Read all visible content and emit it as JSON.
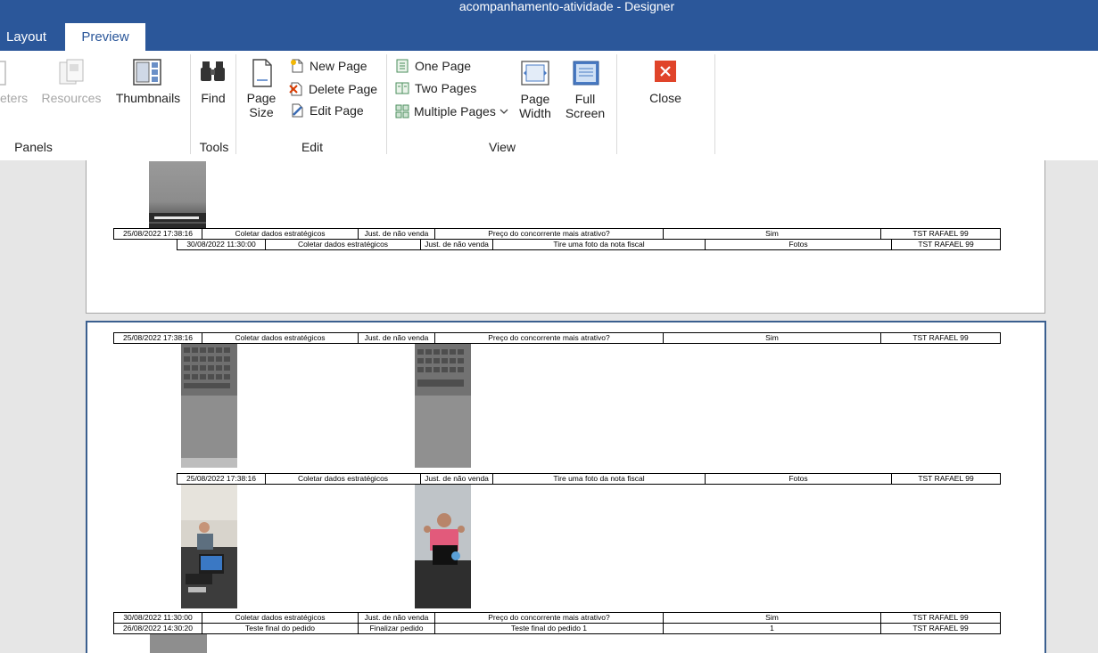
{
  "window": {
    "title": "acompanhamento-atividade - Designer"
  },
  "tabs": {
    "layout": "Layout",
    "preview": "Preview"
  },
  "ribbon": {
    "panels": {
      "parameters": "eters",
      "resources": "Resources",
      "thumbnails": "Thumbnails",
      "group": "Panels"
    },
    "tools": {
      "find": "Find",
      "group": "Tools"
    },
    "edit": {
      "page_size_1": "Page",
      "page_size_2": "Size",
      "new_page": "New Page",
      "delete_page": "Delete Page",
      "edit_page": "Edit Page",
      "group": "Edit"
    },
    "view": {
      "one_page": "One Page",
      "two_pages": "Two Pages",
      "multiple_pages": "Multiple Pages",
      "page_width_1": "Page",
      "page_width_2": "Width",
      "full_screen_1": "Full",
      "full_screen_2": "Screen",
      "group": "View"
    },
    "close": {
      "label": "Close"
    }
  },
  "rows": {
    "p1a": [
      "25/08/2022 17:38:16",
      "Coletar dados estratégicos",
      "Just. de não venda",
      "Preço do concorrente mais atrativo?",
      "Sim",
      "TST RAFAEL 99"
    ],
    "p1b": [
      "30/08/2022 11:30:00",
      "Coletar dados estratégicos",
      "Just. de não venda",
      "Tire uma foto da nota fiscal",
      "Fotos",
      "TST RAFAEL 99"
    ],
    "p2a": [
      "25/08/2022 17:38:16",
      "Coletar dados estratégicos",
      "Just. de não venda",
      "Preço do concorrente mais atrativo?",
      "Sim",
      "TST RAFAEL 99"
    ],
    "p2b": [
      "25/08/2022 17:38:16",
      "Coletar dados estratégicos",
      "Just. de não venda",
      "Tire uma foto da nota fiscal",
      "Fotos",
      "TST RAFAEL 99"
    ],
    "p2c": [
      "30/08/2022 11:30:00",
      "Coletar dados estratégicos",
      "Just. de não venda",
      "Preço do concorrente mais atrativo?",
      "Sim",
      "TST RAFAEL 99"
    ],
    "p2d": [
      "26/08/2022 14:30:20",
      "Teste final do pedido",
      "Finalizar pedido",
      "Teste final do pedido 1",
      "1",
      "TST RAFAEL 99"
    ]
  }
}
